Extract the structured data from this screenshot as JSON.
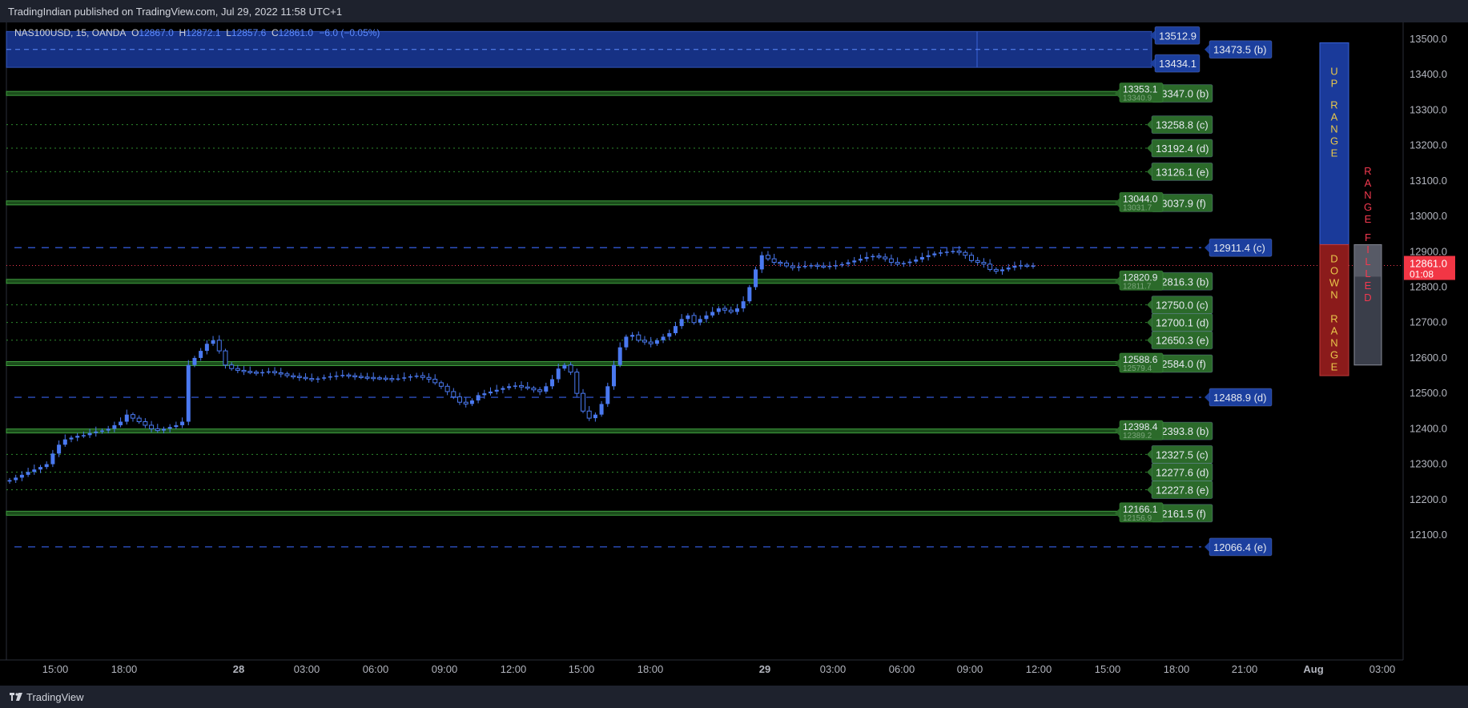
{
  "header": {
    "published_line": "TradingIndian published on TradingView.com, Jul 29, 2022 11:58 UTC+1"
  },
  "legend": {
    "symbol": "NAS100USD, 15, OANDA",
    "o_label": "O",
    "o_value": "12867.0",
    "h_label": "H",
    "h_value": "12872.1",
    "l_label": "L",
    "l_value": "12857.6",
    "c_label": "C",
    "c_value": "12861.0",
    "change": "−6.0 (−0.05%)"
  },
  "footer": {
    "brand": "TradingView"
  },
  "colors": {
    "background": "#000000",
    "candle_up": "#4a79f0",
    "candle_down_outline": "#4a79f0",
    "level_green": "#2e8a2e",
    "label_green": "#2b6a2a",
    "blue_dashed": "#2d4fbf",
    "blue_label": "#1c3f9e",
    "last_price": "#f2394f",
    "up_range_box": "#1a3a9a",
    "down_range_box": "#8b1b1b",
    "range_text_yellow": "#e7c64a",
    "range_filled_text": "#f2394f"
  },
  "chart_data": {
    "type": "candlestick",
    "symbol": "NAS100USD",
    "interval": "15",
    "ylim": [
      12020,
      13560
    ],
    "y_ticks": [
      12100,
      12200,
      12300,
      12400,
      12500,
      12600,
      12700,
      12800,
      12900,
      13000,
      13100,
      13200,
      13300,
      13400,
      13500
    ],
    "x_ticks": [
      "15:00",
      "18:00",
      "28",
      "03:00",
      "06:00",
      "09:00",
      "12:00",
      "15:00",
      "18:00",
      "29",
      "03:00",
      "06:00",
      "09:00",
      "12:00",
      "15:00",
      "18:00",
      "21:00",
      "Aug",
      "03:00"
    ],
    "last_price": {
      "value": 12861.0,
      "label": "12861.0",
      "countdown": "01:08"
    },
    "blue_zone": {
      "top": 13512.9,
      "bottom": 13434.1,
      "top_label": "13512.9",
      "bottom_label": "13434.1",
      "mid_label": "13473.5 (b)"
    },
    "blue_dashed_levels": [
      {
        "value": 12911.4,
        "label": "12911.4 (c)"
      },
      {
        "value": 12488.9,
        "label": "12488.9 (d)"
      },
      {
        "value": 12066.4,
        "label": "12066.4 (e)"
      }
    ],
    "green_bands": [
      {
        "top": 13353.1,
        "bottom": 13340.9,
        "top_label": "13353.1",
        "bottom_label": "13340.9",
        "level_label": "13347.0 (b)"
      },
      {
        "top": 13044.0,
        "bottom": 13031.7,
        "top_label": "13044.0",
        "bottom_label": "13031.7",
        "level_label": "13037.9 (f)"
      },
      {
        "top": 12820.9,
        "bottom": 12811.7,
        "top_label": "12820.9",
        "bottom_label": "12811.7",
        "level_label": "12816.3 (b)"
      },
      {
        "top": 12588.6,
        "bottom": 12579.4,
        "top_label": "12588.6",
        "bottom_label": "12579.4",
        "level_label": "12584.0 (f)"
      },
      {
        "top": 12398.4,
        "bottom": 12389.2,
        "top_label": "12398.4",
        "bottom_label": "12389.2",
        "level_label": "12393.8 (b)"
      },
      {
        "top": 12166.1,
        "bottom": 12156.9,
        "top_label": "12166.1",
        "bottom_label": "12156.9",
        "level_label": "12161.5 (f)"
      }
    ],
    "green_dotted_levels": [
      {
        "value": 13258.8,
        "label": "13258.8 (c)"
      },
      {
        "value": 13192.4,
        "label": "13192.4 (d)"
      },
      {
        "value": 13126.1,
        "label": "13126.1 (e)"
      },
      {
        "value": 12750.0,
        "label": "12750.0 (c)"
      },
      {
        "value": 12700.1,
        "label": "12700.1 (d)"
      },
      {
        "value": 12650.3,
        "label": "12650.3 (e)"
      },
      {
        "value": 12327.5,
        "label": "12327.5 (c)"
      },
      {
        "value": 12277.6,
        "label": "12277.6 (d)"
      },
      {
        "value": 12227.8,
        "label": "12227.8 (e)"
      }
    ],
    "range_boxes": {
      "up_label": [
        "U",
        "P",
        "R",
        "A",
        "N",
        "G",
        "E"
      ],
      "down_label": [
        "D",
        "O",
        "W",
        "N",
        "R",
        "A",
        "N",
        "G",
        "E"
      ],
      "filled_label": [
        "R",
        "A",
        "N",
        "G",
        "E",
        "F",
        "I",
        "L",
        "L",
        "E",
        "D"
      ],
      "up_top": 13490,
      "mid": 12920,
      "down_bottom": 12550,
      "filled_top": 12920,
      "filled_bottom": 12580
    },
    "closes": [
      12255,
      12262,
      12270,
      12278,
      12285,
      12292,
      12300,
      12330,
      12355,
      12370,
      12375,
      12380,
      12382,
      12388,
      12392,
      12395,
      12400,
      12410,
      12420,
      12440,
      12430,
      12420,
      12410,
      12400,
      12395,
      12400,
      12405,
      12410,
      12420,
      12580,
      12600,
      12620,
      12640,
      12650,
      12620,
      12580,
      12570,
      12565,
      12562,
      12560,
      12558,
      12560,
      12562,
      12558,
      12555,
      12550,
      12548,
      12545,
      12542,
      12540,
      12542,
      12545,
      12548,
      12550,
      12552,
      12550,
      12548,
      12546,
      12545,
      12544,
      12543,
      12542,
      12541,
      12542,
      12545,
      12548,
      12550,
      12545,
      12540,
      12530,
      12520,
      12505,
      12490,
      12475,
      12470,
      12480,
      12495,
      12500,
      12505,
      12510,
      12515,
      12520,
      12522,
      12518,
      12515,
      12510,
      12505,
      12520,
      12540,
      12570,
      12580,
      12560,
      12500,
      12450,
      12430,
      12440,
      12470,
      12520,
      12580,
      12630,
      12660,
      12665,
      12650,
      12645,
      12640,
      12650,
      12660,
      12670,
      12690,
      12710,
      12720,
      12700,
      12710,
      12720,
      12730,
      12740,
      12735,
      12730,
      12740,
      12760,
      12800,
      12850,
      12890,
      12880,
      12870,
      12868,
      12860,
      12855,
      12858,
      12860,
      12862,
      12860,
      12858,
      12860,
      12862,
      12865,
      12870,
      12875,
      12880,
      12885,
      12888,
      12885,
      12880,
      12870,
      12865,
      12868,
      12872,
      12878,
      12885,
      12890,
      12895,
      12898,
      12900,
      12902,
      12898,
      12890,
      12875,
      12870,
      12865,
      12850,
      12845,
      12850,
      12855,
      12860,
      12862,
      12860,
      12861
    ]
  }
}
